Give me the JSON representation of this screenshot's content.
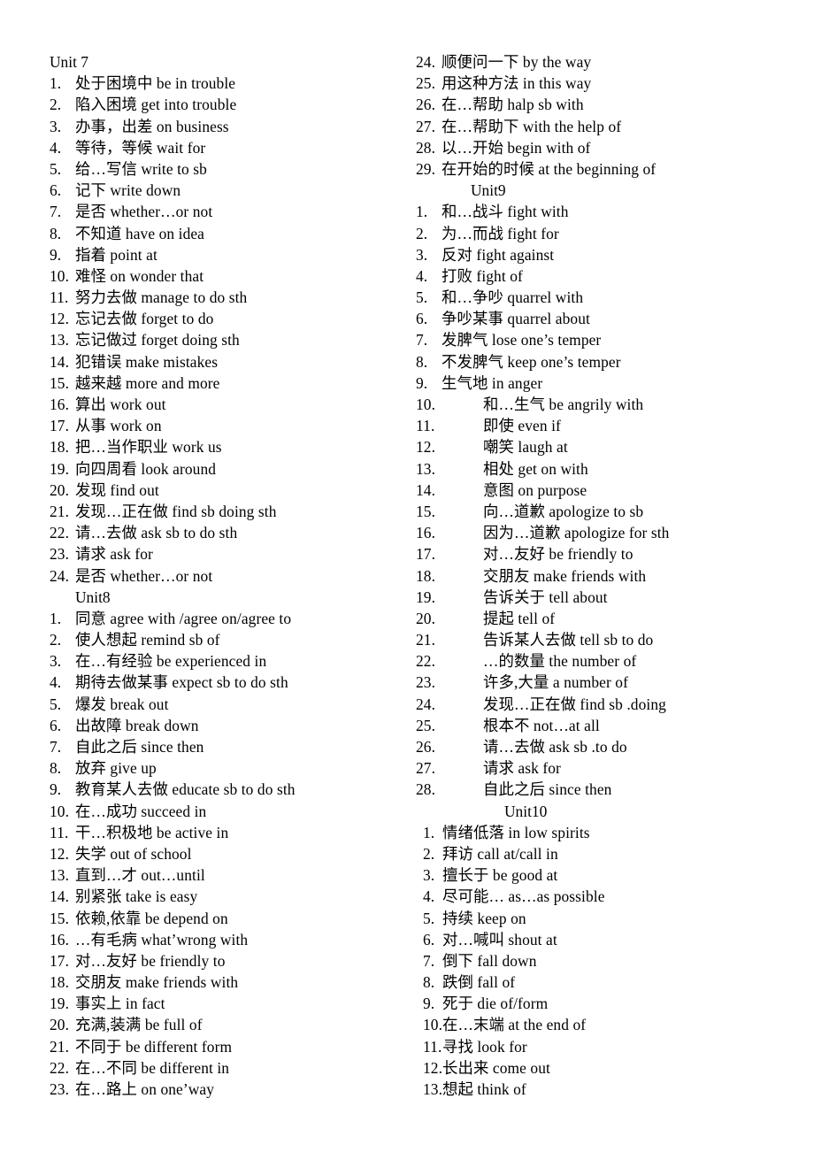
{
  "document": {
    "background_color": "#ffffff",
    "text_color": "#000000",
    "columns": 2
  },
  "left_column": {
    "unit7_heading": "Unit 7",
    "unit7_items": [
      {
        "n": "1.",
        "text": "处于困境中 be in trouble"
      },
      {
        "n": "2.",
        "text": "陷入困境 get into trouble"
      },
      {
        "n": "3.",
        "text": "办事，出差 on business"
      },
      {
        "n": "4.",
        "text": "等待，等候 wait for"
      },
      {
        "n": "5.",
        "text": "给…写信 write to sb"
      },
      {
        "n": "6.",
        "text": "记下 write down"
      },
      {
        "n": "7.",
        "text": "是否 whether…or not"
      },
      {
        "n": "8.",
        "text": "不知道 have on idea"
      },
      {
        "n": "9.",
        "text": "指着 point at"
      },
      {
        "n": "10.",
        "text": "难怪 on wonder that"
      },
      {
        "n": "11.",
        "text": "努力去做 manage to do sth"
      },
      {
        "n": "12.",
        "text": "忘记去做 forget to do"
      },
      {
        "n": "13.",
        "text": "忘记做过 forget doing sth"
      },
      {
        "n": "14.",
        "text": "犯错误 make mistakes"
      },
      {
        "n": "15.",
        "text": "越来越 more and more"
      },
      {
        "n": "16.",
        "text": "算出 work out"
      },
      {
        "n": "17.",
        "text": "从事 work on"
      },
      {
        "n": "18.",
        "text": "把…当作职业 work us"
      },
      {
        "n": "19.",
        "text": "向四周看 look around"
      },
      {
        "n": "20.",
        "text": "发现 find out"
      },
      {
        "n": "21.",
        "text": "发现…正在做 find sb doing sth"
      },
      {
        "n": "22.",
        "text": "请…去做 ask sb to do sth"
      },
      {
        "n": "23.",
        "text": "请求 ask for"
      },
      {
        "n": "24.",
        "text": "是否 whether…or not"
      }
    ],
    "unit8_heading": "Unit8",
    "unit8_items": [
      {
        "n": "1.",
        "text": "同意 agree with /agree on/agree to"
      },
      {
        "n": "2.",
        "text": "使人想起 remind sb of"
      },
      {
        "n": "3.",
        "text": "在…有经验 be experienced in"
      },
      {
        "n": "4.",
        "text": "期待去做某事 expect sb to do sth"
      },
      {
        "n": "5.",
        "text": "爆发 break out"
      },
      {
        "n": "6.",
        "text": "出故障 break down"
      },
      {
        "n": "7.",
        "text": "自此之后 since then"
      },
      {
        "n": "8.",
        "text": "放弃 give up"
      },
      {
        "n": "9.",
        "text": "教育某人去做 educate sb to do sth"
      },
      {
        "n": "10.",
        "text": "在…成功 succeed in"
      },
      {
        "n": "11.",
        "text": "干…积极地 be active in"
      },
      {
        "n": "12.",
        "text": "失学 out of school"
      },
      {
        "n": "13.",
        "text": "直到…才 out…until"
      },
      {
        "n": "14.",
        "text": "别紧张 take is easy"
      },
      {
        "n": "15.",
        "text": "依赖,依靠 be depend on"
      },
      {
        "n": "16.",
        "text": "…有毛病 what’wrong with"
      },
      {
        "n": "17.",
        "text": "对…友好 be friendly to"
      },
      {
        "n": "18.",
        "text": "交朋友 make friends with"
      },
      {
        "n": "19.",
        "text": "事实上 in fact"
      },
      {
        "n": "20.",
        "text": "充满,装满 be full of"
      },
      {
        "n": "21.",
        "text": "不同于 be different form"
      },
      {
        "n": "22.",
        "text": "在…不同 be different in"
      },
      {
        "n": "23.",
        "text": "在…路上 on one’way"
      }
    ]
  },
  "right_column": {
    "unit8_continued_items": [
      {
        "n": "24.",
        "text": "顺便问一下 by the way"
      },
      {
        "n": "25.",
        "text": "用这种方法 in this way"
      },
      {
        "n": "26.",
        "text": "在…帮助 halp sb with"
      },
      {
        "n": "27.",
        "text": "在…帮助下 with the help of"
      },
      {
        "n": "28.",
        "text": "以…开始 begin with of"
      },
      {
        "n": "29.",
        "text": "在开始的时候 at the beginning of"
      }
    ],
    "unit9_heading": "Unit9",
    "unit9_items": [
      {
        "n": "1.",
        "text": "和…战斗 fight with",
        "deep": false
      },
      {
        "n": "2.",
        "text": "为…而战 fight for",
        "deep": false
      },
      {
        "n": "3.",
        "text": "反对 fight against",
        "deep": false
      },
      {
        "n": "4.",
        "text": "打败 fight of",
        "deep": false
      },
      {
        "n": "5.",
        "text": "和…争吵 quarrel with",
        "deep": false
      },
      {
        "n": "6.",
        "text": "争吵某事 quarrel about",
        "deep": false
      },
      {
        "n": "7.",
        "text": "发脾气 lose one’s temper",
        "deep": false
      },
      {
        "n": "8.",
        "text": "不发脾气 keep one’s temper",
        "deep": false
      },
      {
        "n": "9.",
        "text": "生气地 in anger",
        "deep": false
      },
      {
        "n": "10.",
        "text": "和…生气 be angrily with",
        "deep": true
      },
      {
        "n": "11.",
        "text": "即使 even if",
        "deep": true
      },
      {
        "n": "12.",
        "text": "嘲笑 laugh at",
        "deep": true
      },
      {
        "n": "13.",
        "text": "相处 get on with",
        "deep": true
      },
      {
        "n": "14.",
        "text": "意图 on purpose",
        "deep": true
      },
      {
        "n": "15.",
        "text": "向…道歉 apologize to sb",
        "deep": true
      },
      {
        "n": "16.",
        "text": "因为…道歉 apologize for sth",
        "deep": true
      },
      {
        "n": "17.",
        "text": "对…友好 be friendly to",
        "deep": true
      },
      {
        "n": "18.",
        "text": "交朋友 make friends with",
        "deep": true
      },
      {
        "n": "19.",
        "text": "告诉关于 tell about",
        "deep": true
      },
      {
        "n": "20.",
        "text": "提起 tell of",
        "deep": true
      },
      {
        "n": "21.",
        "text": "告诉某人去做 tell sb to do",
        "deep": true
      },
      {
        "n": "22.",
        "text": "…的数量 the number of",
        "deep": true
      },
      {
        "n": "23.",
        "text": "许多,大量 a number of",
        "deep": true
      },
      {
        "n": "24.",
        "text": "发现…正在做 find sb .doing",
        "deep": true
      },
      {
        "n": "25.",
        "text": "根本不 not…at all",
        "deep": true
      },
      {
        "n": "26.",
        "text": "请…去做 ask sb .to do",
        "deep": true
      },
      {
        "n": "27.",
        "text": "请求 ask for",
        "deep": true
      },
      {
        "n": "28.",
        "text": "自此之后 since then",
        "deep": true
      }
    ],
    "unit10_heading": "Unit10",
    "unit10_items": [
      {
        "n": "1.",
        "text": "情绪低落 in low spirits"
      },
      {
        "n": "2.",
        "text": "拜访 call at/call in"
      },
      {
        "n": "3.",
        "text": "擅长于 be good at"
      },
      {
        "n": "4.",
        "text": "尽可能… as…as possible"
      },
      {
        "n": "5.",
        "text": "持续 keep on"
      },
      {
        "n": "6.",
        "text": "对…喊叫 shout at"
      },
      {
        "n": "7.",
        "text": "倒下 fall down"
      },
      {
        "n": "8.",
        "text": "跌倒 fall of"
      },
      {
        "n": "9.",
        "text": "死于 die of/form"
      },
      {
        "n": "10.",
        "text": "在…末端 at the end of"
      },
      {
        "n": "11.",
        "text": "寻找 look for"
      },
      {
        "n": "12.",
        "text": "长出来 come out"
      },
      {
        "n": "13.",
        "text": "想起 think of"
      }
    ]
  }
}
